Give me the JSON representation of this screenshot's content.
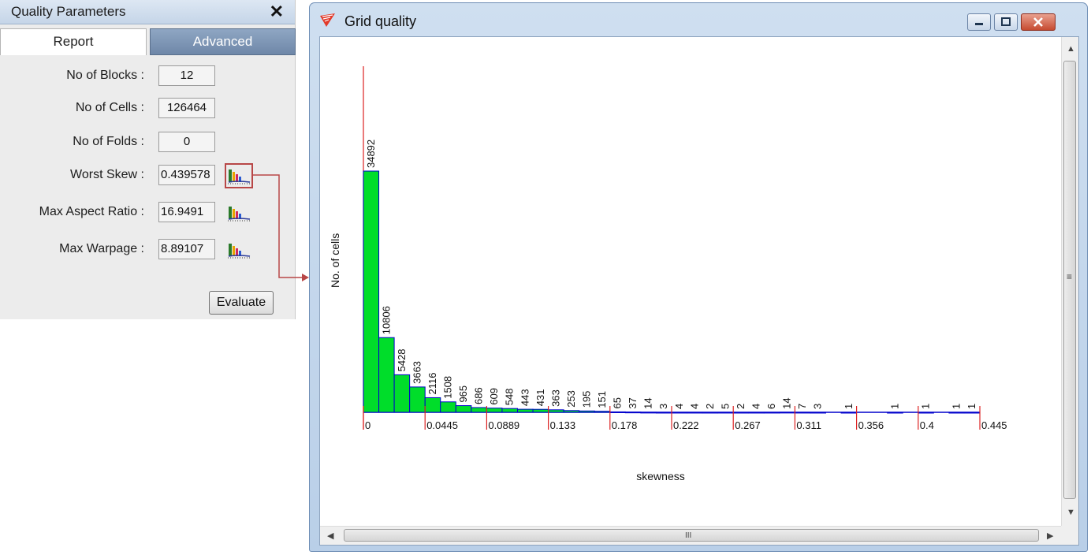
{
  "panel": {
    "title": "Quality Parameters",
    "tabs": [
      {
        "label": "Report",
        "active": true
      },
      {
        "label": "Advanced",
        "active": false
      }
    ],
    "rows": [
      {
        "label": "No of Blocks :",
        "value": "12"
      },
      {
        "label": "No of Cells :",
        "value": "126464"
      },
      {
        "label": "No of Folds :",
        "value": "0"
      },
      {
        "label": "Worst Skew :",
        "value": "0.439578"
      },
      {
        "label": "Max Aspect Ratio :",
        "value": "16.9491"
      },
      {
        "label": "Max Warpage :",
        "value": "8.89107"
      }
    ],
    "evaluate_label": "Evaluate"
  },
  "window": {
    "title": "Grid quality",
    "hscroll_grip": "III",
    "vscroll_grip": "≡",
    "colors": {
      "bar_fill": "#00dd2a",
      "bar_stroke": "#0000cc",
      "tick": "#dd2222",
      "axis": "#0000cc"
    }
  },
  "chart_data": {
    "type": "bar",
    "xlabel": "skewness",
    "ylabel": "No. of cells",
    "x_ticks": [
      "0",
      "0.0445",
      "0.0889",
      "0.133",
      "0.178",
      "0.222",
      "0.267",
      "0.311",
      "0.356",
      "0.4",
      "0.445"
    ],
    "xlim": [
      0,
      0.445
    ],
    "ylim": [
      0,
      34892
    ],
    "values": [
      34892,
      10806,
      5428,
      3663,
      2116,
      1508,
      965,
      686,
      609,
      548,
      443,
      431,
      363,
      253,
      195,
      151,
      65,
      37,
      14,
      3,
      4,
      4,
      2,
      5,
      2,
      4,
      6,
      14,
      7,
      3,
      0,
      1,
      0,
      0,
      1,
      0,
      1,
      0,
      1,
      1
    ],
    "value_labels": [
      "34892",
      "10806",
      "5428",
      "3663",
      "2116",
      "1508",
      "965",
      "686",
      "609",
      "548",
      "443",
      "431",
      "363",
      "253",
      "195",
      "151",
      "65",
      "37",
      "14",
      "3",
      "4",
      "4",
      "2",
      "5",
      "2",
      "4",
      "6",
      "14",
      "7",
      "3",
      "",
      "1",
      "",
      "",
      "1",
      "",
      "1",
      "",
      "1",
      "1"
    ]
  }
}
